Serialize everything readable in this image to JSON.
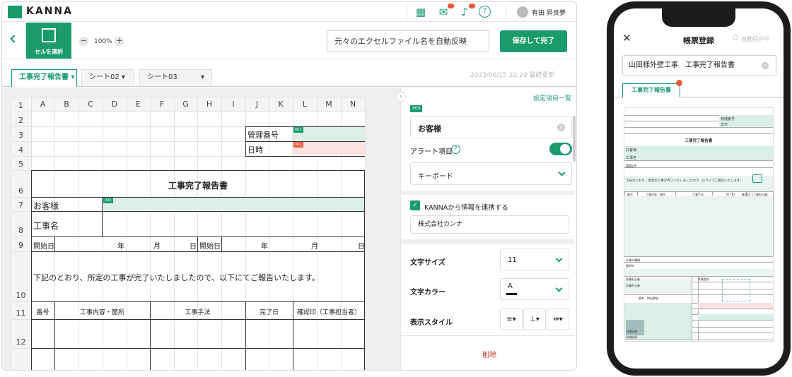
{
  "app": {
    "brand": "KANNA",
    "user_name": "有田 昇良夢"
  },
  "toolbar": {
    "select_cell_label": "セルを選択",
    "zoom": "100%",
    "file_name": "元々のエクセルファイル名を自動反映",
    "save_label": "保存して完了"
  },
  "tabs": [
    {
      "label": "工事完了報告書",
      "active": true
    },
    {
      "label": "シート02",
      "active": false
    },
    {
      "label": "シート03",
      "active": false
    }
  ],
  "last_updated": "2023/06/15 22:20 最終更新",
  "grid": {
    "columns": [
      "A",
      "B",
      "C",
      "D",
      "E",
      "F",
      "G",
      "H",
      "I",
      "J",
      "K",
      "L",
      "M",
      "N"
    ],
    "rows": [
      "1",
      "2",
      "3",
      "4",
      "5",
      "6",
      "7",
      "8",
      "9",
      "10",
      "11",
      "12"
    ],
    "cells": {
      "mgmt_no": "管理番号",
      "datetime": "日時",
      "title": "工事完了報告書",
      "customer": "お客様",
      "work_name": "工事名",
      "start_date": "開始日",
      "year": "年",
      "month": "月",
      "day": "日",
      "start_date2": "開始日",
      "year2": "年",
      "month2": "月",
      "day2": "日",
      "notice": "下記のとおり、所定の工事が完了いたしましたので、以下にてご報告いたします。",
      "col_no": "番号",
      "col_content": "工事内容・箇所",
      "col_method": "工事手法",
      "col_done": "完了日",
      "col_confirm": "確認印（工事担当者）"
    },
    "tags": {
      "t001": "001",
      "t002": "002",
      "t003": "003"
    }
  },
  "panel": {
    "settings_link": "設定項目一覧",
    "item_tag": "003",
    "item_name": "お客様",
    "alert_label": "アラート項目",
    "alert_on": true,
    "input_type": "キーボード",
    "link_label": "KANNAから情報を連携する",
    "link_checked": true,
    "company": "株式会社カンナ",
    "font_size_label": "文字サイズ",
    "font_size": "11",
    "font_color_label": "文字カラー",
    "font_color_value": "A",
    "display_style_label": "表示スタイル",
    "delete_label": "削除"
  },
  "phone": {
    "title": "帳票登録",
    "autosave": "自動保存中",
    "doc_title": "山田様外壁工事　工事完了報告書",
    "tab": "工事完了報告書",
    "mini": {
      "mgmt": "管理番号",
      "date": "日付",
      "report_title": "工事完了報告書",
      "customer": "お客様",
      "work_name": "工事名",
      "start": "開始日",
      "notice": "下記のとおり、所定の工事が完了いたしましたので、以下にてご報告いたします。",
      "no": "番号",
      "content": "工事内容・箇所",
      "method": "工事手法",
      "done": "完了日",
      "confirm": "確認印（工事担当者）",
      "shape": "大棟の種類",
      "material": "屋根材",
      "worker1": "作業担当者",
      "worker2": "作業担当者",
      "remarks": "備考・特記事項",
      "floorplan": "作業箇所",
      "result1": "点検結果",
      "result2": "点検結果"
    }
  },
  "colors": {
    "accent": "#1a9b6c",
    "alert": "#e65a3d",
    "green_cell": "#dcefe6",
    "red_cell": "#fbe4e0"
  }
}
